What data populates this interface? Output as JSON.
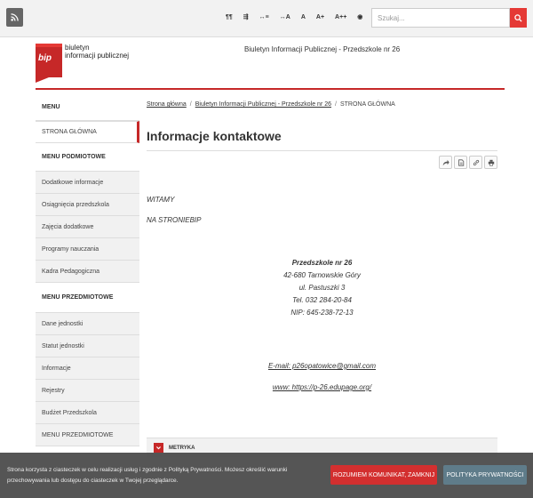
{
  "topbar": {
    "rss_icon": "rss-icon",
    "tools": [
      "¶¶",
      "⇶",
      "↔≡",
      "↔A",
      "A",
      "A+",
      "A++",
      "◉"
    ],
    "search_placeholder": "Szukaj...",
    "search_icon": "search-icon"
  },
  "header": {
    "logo_mark": "bip",
    "logo_line1": "biuletyn",
    "logo_line2": "informacji publicznej",
    "site_title": "Biuletyn Informacji Publicznej -  Przedszkole nr 26"
  },
  "sidebar": {
    "menu_head": "MENU",
    "home": "STRONA GŁÓWNA",
    "podmiotowe_head": "MENU PODMIOTOWE",
    "podmiotowe_items": [
      "Dodatkowe informacje",
      "Osiągnięcia przedszkola",
      "Zajęcia dodatkowe",
      "Programy nauczania",
      "Kadra Pedagogiczna"
    ],
    "przedmiotowe_head": "MENU PRZEDMIOTOWE",
    "przedmiotowe_items": [
      "Dane jednostki",
      "Statut jednostki",
      "Informacje",
      "Rejestry",
      "Budżet Przedszkola",
      "MENU PRZEDMIOTOWE"
    ]
  },
  "breadcrumb": {
    "home": "Strona główna",
    "bip": "Biuletyn Informacji Publicznej - Przedszkole nr 26",
    "current": "STRONA GŁÓWNA",
    "sep": "/"
  },
  "content": {
    "title": "Informacje kontaktowe",
    "action_icons": [
      "share-icon",
      "document-icon",
      "link-icon",
      "print-icon"
    ],
    "welcome1": "WITAMY",
    "welcome2": " NA STRONIEBIP",
    "org_name": "Przedszkole nr 26",
    "address1": "42-680 Tarnowskie Góry",
    "address2": "ul. Pastuszki 3",
    "phone": "Tel. 032 284-20-84",
    "nip": "NIP: 645-238-72-13",
    "email": "E-mail: p26opatowice@gmail.com",
    "www": "www: https://p-26.edupage.org/",
    "metryka": "METRYKA"
  },
  "cookie": {
    "text": "Strona korzysta z ciasteczek w celu realizacji usług i zgodnie z Polityką Prywatności. Możesz określić warunki przechowywania lub dostępu do ciasteczek w Twojej przeglądarce.",
    "accept": "ROZUMIEM KOMUNIKAT, ZAMKNIJ",
    "policy": "POLITYKA PRYWATNOŚCI"
  }
}
